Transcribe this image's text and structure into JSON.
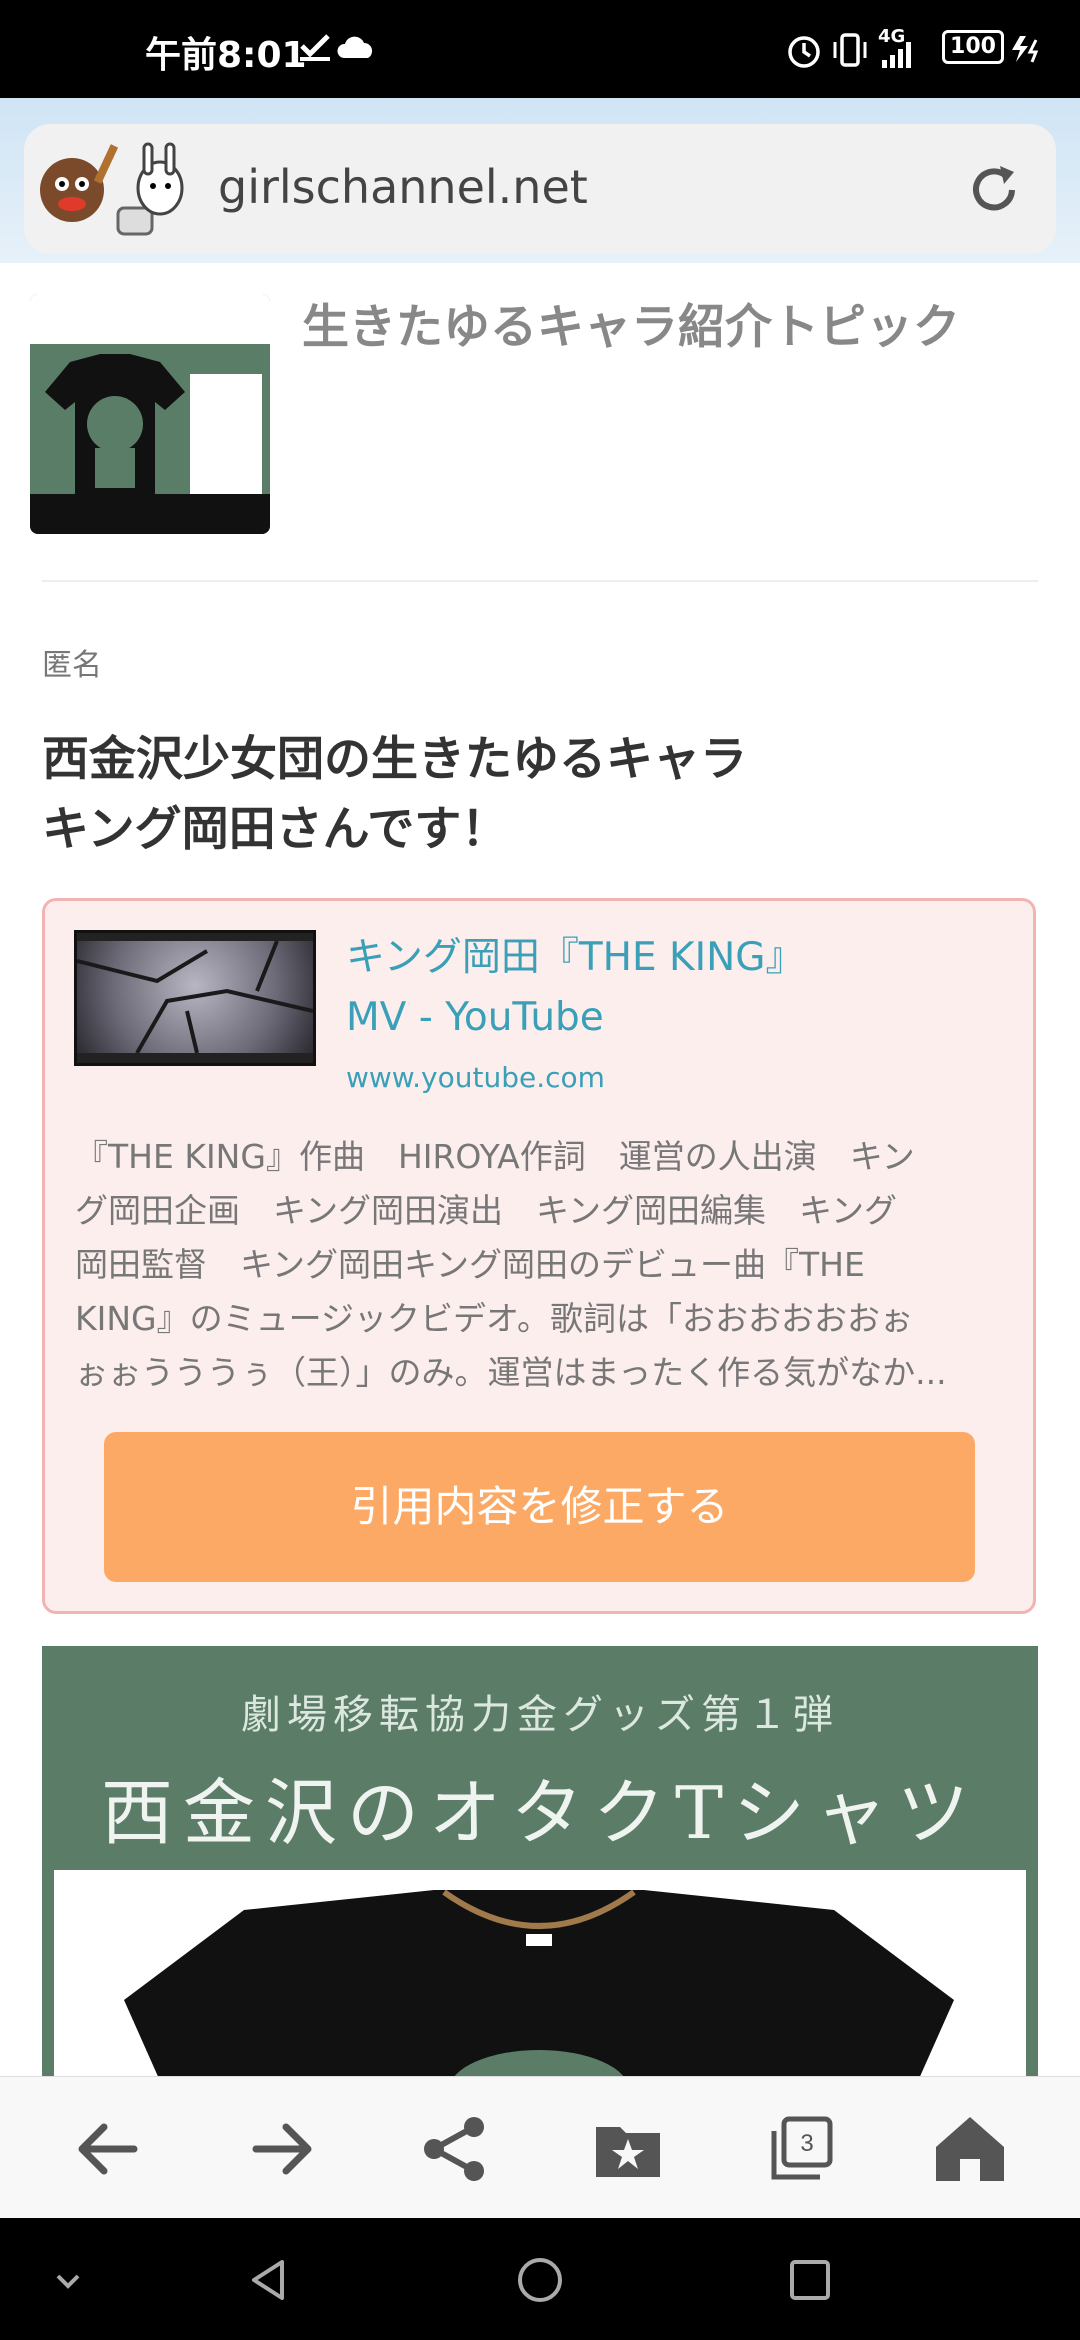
{
  "status_bar": {
    "time": "午前8:01",
    "network": "4G",
    "battery": "100"
  },
  "browser": {
    "url": "girlschannel.net"
  },
  "topic": {
    "title": "生きたゆるキャラ紹介トピック"
  },
  "post": {
    "author": "匿名",
    "body_line1": "西金沢少女団の生きたゆるキャラ",
    "body_line2": "キング岡田さんです！"
  },
  "quote": {
    "title_line1": "キング岡田『THE KING』",
    "title_line2": "MV - YouTube",
    "domain": "www.youtube.com",
    "desc_line1": "『THE KING』作曲　HIROYA作詞　運営の人出演　キン",
    "desc_line2": "グ岡田企画　キング岡田演出　キング岡田編集　キング",
    "desc_line3": "岡田監督　キング岡田キング岡田のデビュー曲『THE",
    "desc_line4": "KING』のミュージックビデオ。歌詞は「おおおおおおぉ",
    "desc_line5": "ぉぉうううぅ（王）」のみ。運営はまったく作る気がなか...",
    "button_label": "引用内容を修正する"
  },
  "image": {
    "line1": "劇場移転協力金グッズ第１弾",
    "line2": "西金沢のオタクTシャツ"
  },
  "toolbar": {
    "tab_count": "3"
  },
  "colors": {
    "accent_teal": "#3aa0b8",
    "button_orange": "#fda966",
    "quote_border": "#f3b3b3",
    "quote_bg": "#fdeeee"
  }
}
